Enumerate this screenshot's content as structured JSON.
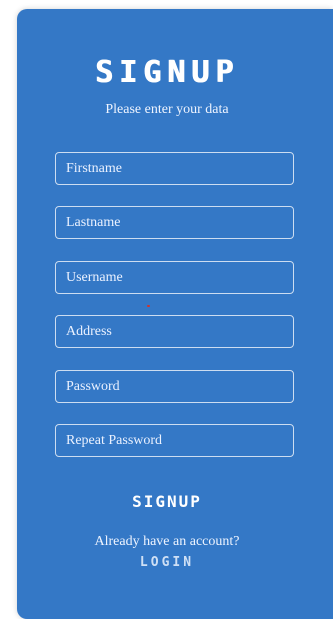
{
  "form": {
    "title": "SIGNUP",
    "subtitle": "Please enter your data",
    "fields": {
      "firstname": {
        "placeholder": "Firstname",
        "value": ""
      },
      "lastname": {
        "placeholder": "Lastname",
        "value": ""
      },
      "username": {
        "placeholder": "Username",
        "value": ""
      },
      "address": {
        "placeholder": "Address",
        "value": ""
      },
      "password": {
        "placeholder": "Password",
        "value": ""
      },
      "repeat_password": {
        "placeholder": "Repeat Password",
        "value": ""
      }
    },
    "submit_label": "SIGNUP",
    "account_prompt": "Already have an account?",
    "login_label": "LOGIN"
  },
  "colors": {
    "card_background": "#3478c6",
    "text": "#ffffff",
    "field_border": "#ffffff",
    "login_link": "#cfe0f5"
  }
}
